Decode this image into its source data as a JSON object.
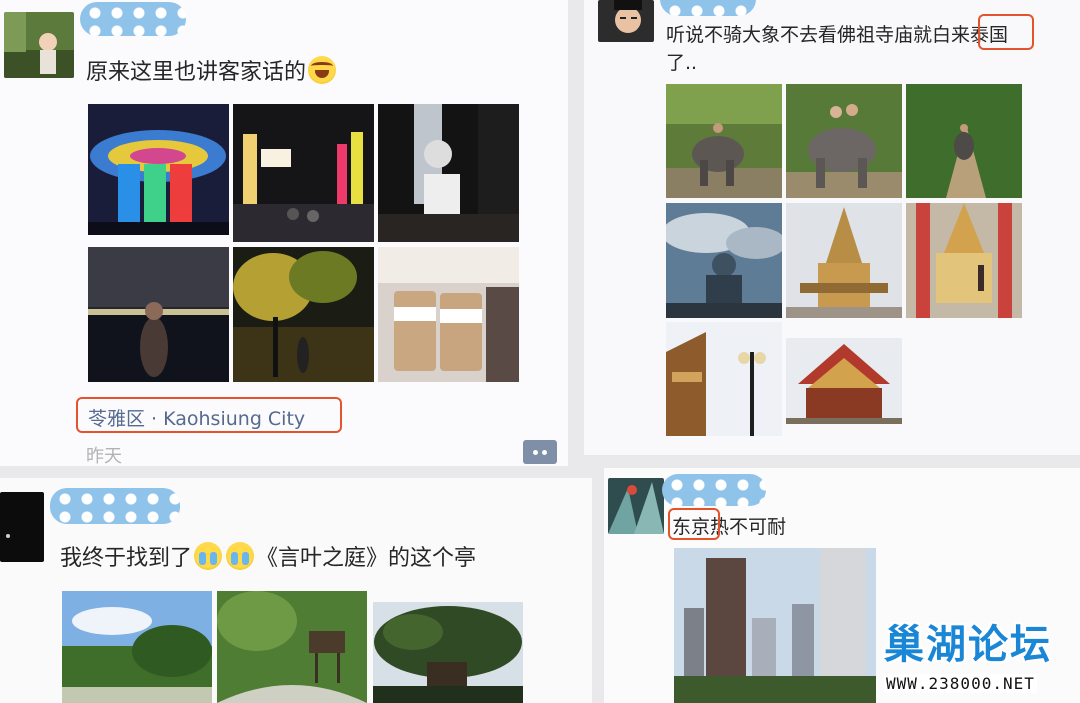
{
  "post1": {
    "text": "原来这里也讲客家话的",
    "location": "苓雅区 · Kaohsiung City",
    "time": "昨天"
  },
  "post2": {
    "text_line1": "听说不骑大象不去看佛祖寺庙就白来泰国",
    "text_line2": "了.."
  },
  "post3": {
    "text_prefix": "我终于找到了",
    "text_suffix": "《言叶之庭》的这个亭"
  },
  "post4": {
    "text": "东京热不可耐"
  },
  "watermark": {
    "logo": "巢湖论坛",
    "url": "WWW.238000.NET"
  },
  "colors": {
    "highlight": "#e3542c",
    "link": "#56698f",
    "mask": "#8fc3ea",
    "brand": "#1a86d6"
  }
}
